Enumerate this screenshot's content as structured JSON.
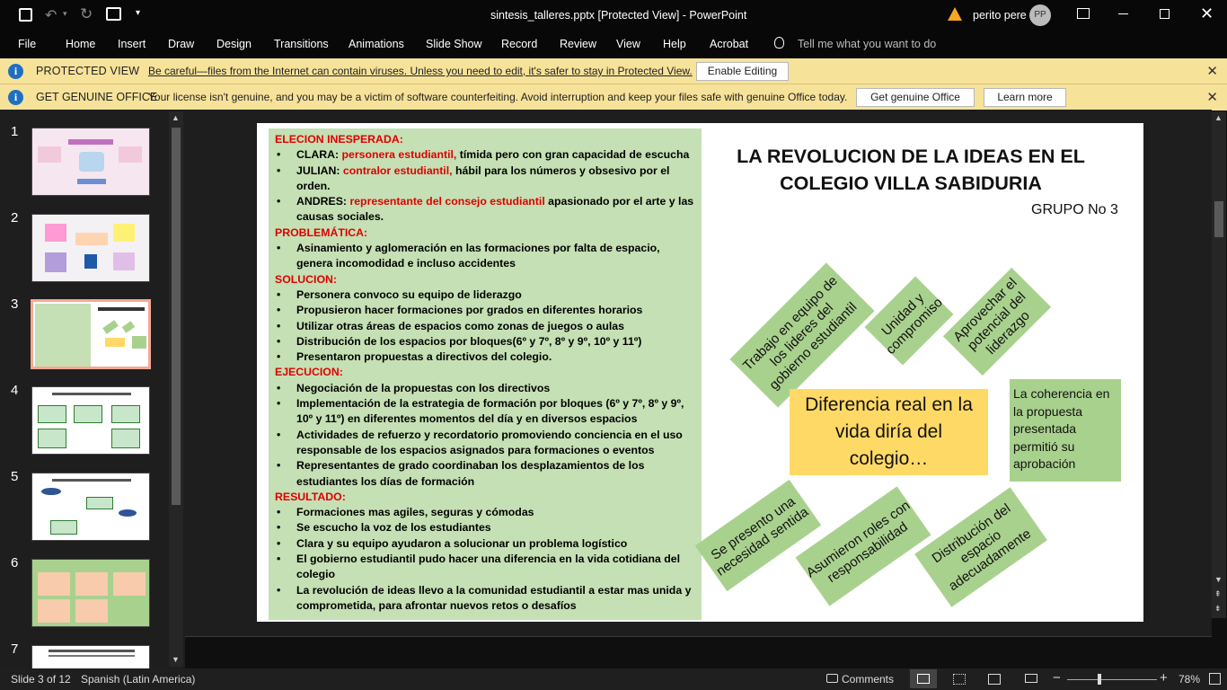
{
  "window": {
    "title": "sintesis_talleres.pptx [Protected View] - PowerPoint",
    "user_name": "perito pere",
    "user_initials": "PP"
  },
  "menu": {
    "items": [
      "File",
      "Home",
      "Insert",
      "Draw",
      "Design",
      "Transitions",
      "Animations",
      "Slide Show",
      "Record",
      "Review",
      "View",
      "Help",
      "Acrobat"
    ],
    "tell_me": "Tell me what you want to do"
  },
  "protected_bar": {
    "title": "PROTECTED VIEW",
    "message": "Be careful—files from the Internet can contain viruses. Unless you need to edit, it's safer to stay in Protected View.",
    "button": "Enable Editing"
  },
  "genuine_bar": {
    "title": "GET GENUINE OFFICE",
    "message": "Your license isn't genuine, and you may be a victim of software counterfeiting. Avoid interruption and keep your files safe with genuine Office today.",
    "button1": "Get genuine Office",
    "button2": "Learn more"
  },
  "thumbnails": {
    "numbers": [
      "1",
      "2",
      "3",
      "4",
      "5",
      "6",
      "7"
    ],
    "selected": 3
  },
  "slide": {
    "title": "LA REVOLUCION DE LA IDEAS  EN EL COLEGIO VILLA SABIDURIA",
    "group": "GRUPO No 3",
    "left": {
      "h1": "ELECION INESPERADA:",
      "clara_name": "CLARA: ",
      "clara_role": "personera estudiantil,",
      "clara_desc": " tímida pero con gran capacidad de escucha",
      "julian_name": "JULIAN: ",
      "julian_role": "contralor estudiantil,",
      "julian_desc": " hábil para los números y obsesivo por el orden.",
      "andres_name": "ANDRES: ",
      "andres_role": "representante del consejo estudiantil",
      "andres_desc": " apasionado por el arte y las causas sociales.",
      "h2": "PROBLEMÁTICA:",
      "prob": [
        "Asinamiento y aglomeración en las formaciones por falta de espacio, genera incomodidad e incluso accidentes"
      ],
      "h3": "SOLUCION:",
      "sol": [
        "Personera convoco su equipo de liderazgo",
        "Propusieron hacer formaciones por grados en diferentes horarios",
        "Utilizar otras áreas de espacios como zonas de juegos o aulas",
        "Distribución de los espacios por bloques(6º y 7º, 8º y 9º, 10º y 11º)",
        "Presentaron propuestas a directivos del colegio."
      ],
      "h4": "EJECUCION:",
      "eje": [
        "Negociación de la propuestas con los directivos",
        "Implementación de la estrategia de formación por bloques (6º y 7º, 8º y 9º, 10º y 11º) en diferentes momentos del día y en diversos espacios",
        "Actividades de refuerzo y recordatorio promoviendo conciencia en el uso responsable de los espacios asignados para formaciones o eventos",
        "Representantes de grado coordinaban los desplazamientos de los estudiantes los días de formación"
      ],
      "h5": "RESULTADO:",
      "res": [
        "Formaciones mas agiles, seguras y cómodas",
        "Se escucho la voz de los estudiantes",
        "Clara y su equipo ayudaron a solucionar un problema logístico",
        "El gobierno estudiantil pudo hacer una diferencia en la vida cotidiana del colegio",
        "La revolución de ideas llevo a la comunidad estudiantil a estar mas unida y comprometida, para afrontar nuevos retos o desafíos"
      ]
    },
    "center": "Diferencia real en la vida diría del colegio…",
    "boxes": {
      "b1": "Trabajo en equipo de los lideres del gobierno estudiantil",
      "b2": "Unidad y compromiso",
      "b3": "Aprovechar el potencial del liderazgo",
      "b4": "La coherencia en la propuesta presentada permitió su aprobación",
      "b5": "Se presento una necesidad sentida",
      "b6": "Asumieron roles con responsabilidad",
      "b7": "Distribución del espacio adecuadamente"
    }
  },
  "status": {
    "slide_info": "Slide 3 of 12",
    "language": "Spanish (Latin America)",
    "comments": "Comments",
    "zoom": "78%"
  },
  "colors": {
    "accent_red": "#e00000",
    "green_box": "#a9d18e",
    "panel_green": "#c5e0b4",
    "yellow": "#ffd966",
    "bar_yellow": "#f7e29a"
  }
}
